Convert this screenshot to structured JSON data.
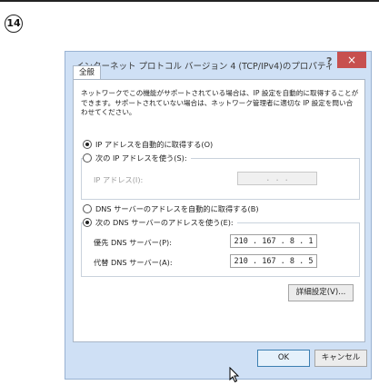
{
  "step_number": "14",
  "dialog": {
    "title": "インターネット プロトコル バージョン 4 (TCP/IPv4)のプロパティ",
    "help_label": "?",
    "close_label": "×",
    "tab_general": "全般",
    "description": "ネットワークでこの機能がサポートされている場合は、IP 設定を自動的に取得することができます。サポートされていない場合は、ネットワーク管理者に適切な IP 設定を問い合わせてください。",
    "ip_auto_label": "IP アドレスを自動的に取得する(O)",
    "ip_manual_label": "次の IP アドレスを使う(S):",
    "ip_address_label": "IP アドレス(I):",
    "ip_address_value": ".      .      .",
    "dns_auto_label": "DNS サーバーのアドレスを自動的に取得する(B)",
    "dns_manual_label": "次の DNS サーバーのアドレスを使う(E):",
    "preferred_dns_label": "優先 DNS サーバー(P):",
    "preferred_dns_value": "210 . 167 . 8 . 1",
    "alternate_dns_label": "代替 DNS サーバー(A):",
    "alternate_dns_value": "210 . 167 . 8 . 5",
    "advanced_button": "詳細設定(V)...",
    "ok_button": "OK",
    "cancel_button": "キャンセル"
  },
  "state": {
    "ip_mode": "auto",
    "dns_mode": "manual"
  },
  "colors": {
    "dialog_frame": "#cfe0f5",
    "close_button": "#c7504f"
  }
}
